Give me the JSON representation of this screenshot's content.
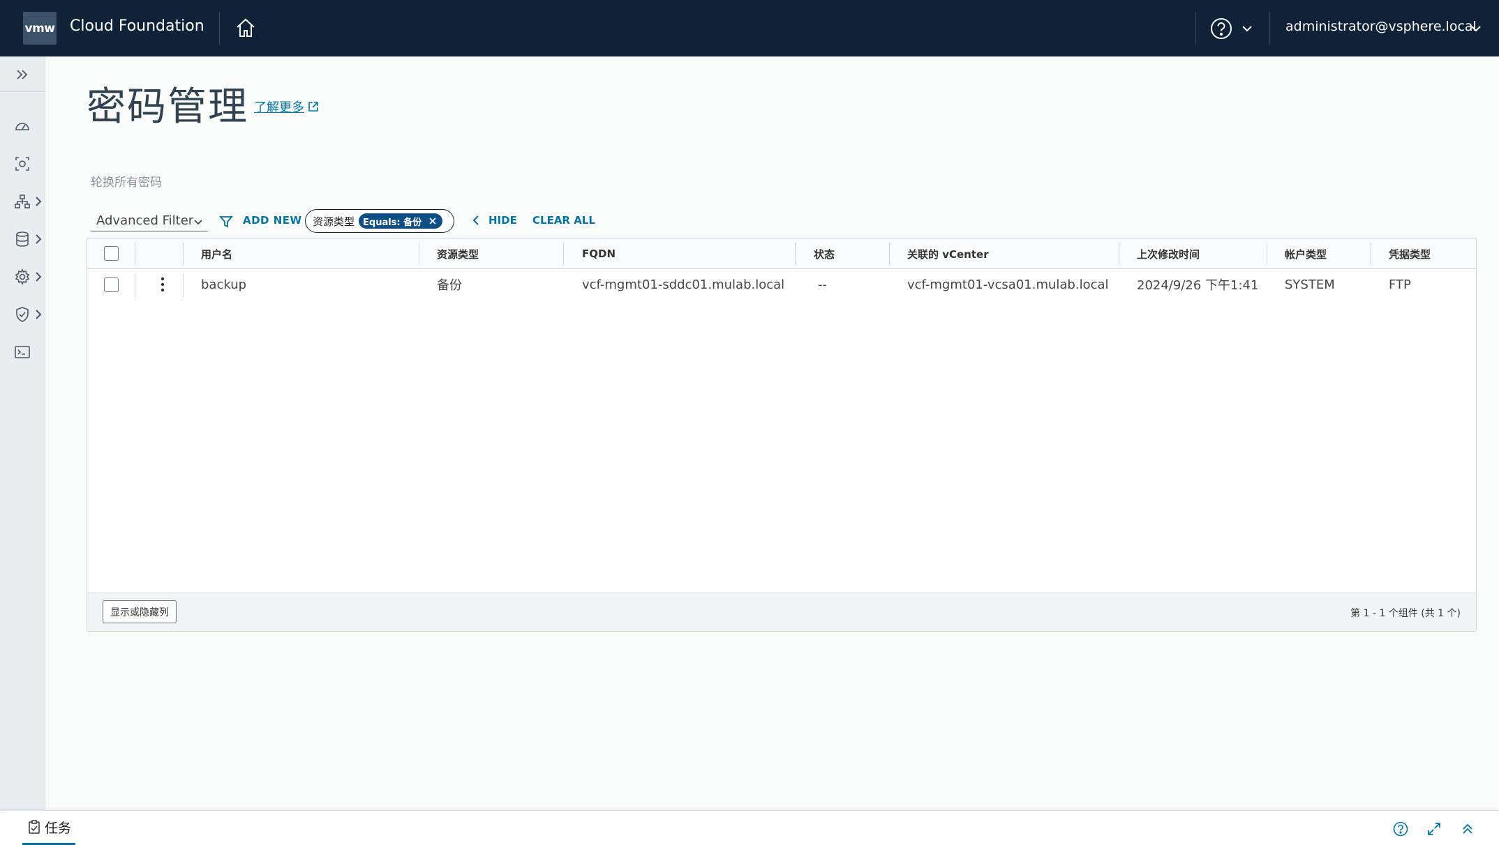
{
  "header": {
    "logo": "vmw",
    "app_title": "Cloud Foundation",
    "user": "administrator@vsphere.local"
  },
  "page": {
    "title": "密码管理",
    "learn_more": "了解更多",
    "rotate_all": "轮换所有密码"
  },
  "filter": {
    "advanced_filter": "Advanced Filter",
    "add_new": "ADD NEW",
    "chip_key": "资源类型",
    "chip_value": "Equals: 备份",
    "hide": "HIDE",
    "clear_all": "CLEAR ALL"
  },
  "grid": {
    "columns": [
      "用户名",
      "资源类型",
      "FQDN",
      "状态",
      "关联的 vCenter",
      "上次修改时间",
      "帐户类型",
      "凭据类型"
    ],
    "rows": [
      [
        "backup",
        "备份",
        "vcf-mgmt01-sddc01.mulab.local",
        "--",
        "vcf-mgmt01-vcsa01.mulab.local",
        "2024/9/26 下午1:41",
        "SYSTEM",
        "FTP"
      ]
    ],
    "show_hide_columns": "显示或隐藏列",
    "pagination": "第 1 - 1 个组件 (共 1 个)"
  },
  "bottom_bar": {
    "tasks_label": "任务"
  },
  "colors": {
    "header_bg": "#0f2237",
    "accent": "#0072a3",
    "chip_bg": "#0f4d85",
    "sidebar_bg": "#e8edf0"
  }
}
